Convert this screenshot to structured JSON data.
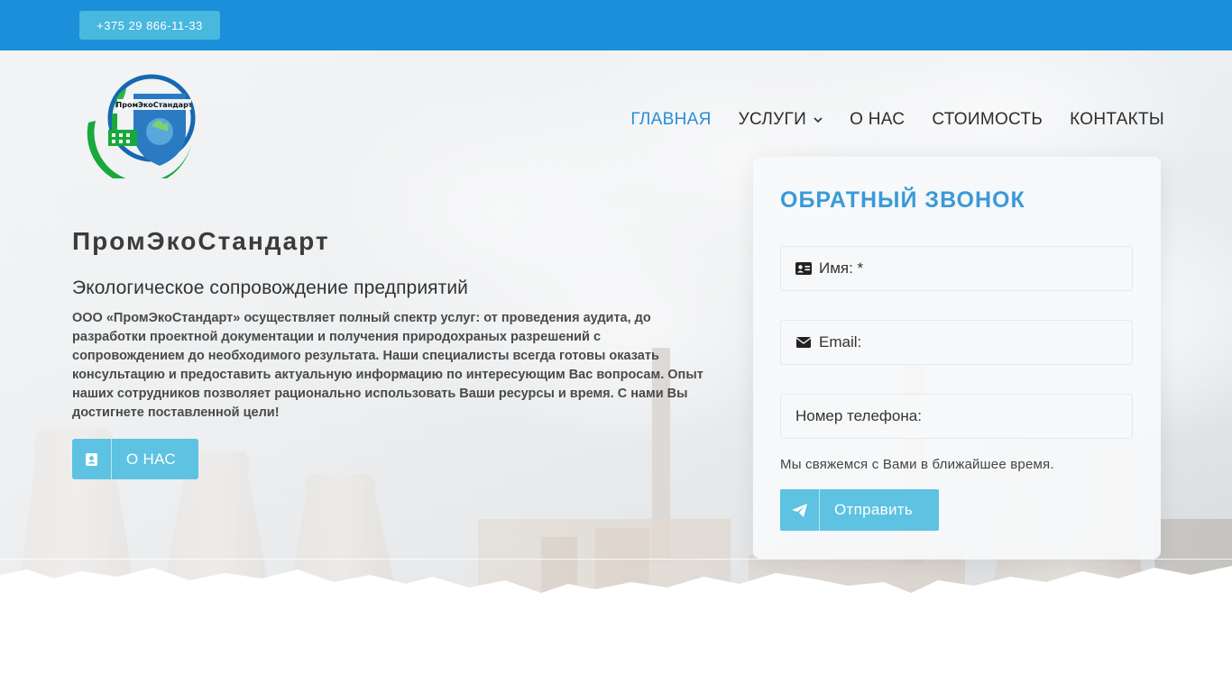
{
  "topbar": {
    "phone": "+375 29 866-11-33"
  },
  "logo": {
    "text": "ПромЭкоСтандарт",
    "icon": "company-logo-icon"
  },
  "nav": {
    "items": [
      {
        "label": "ГЛАВНАЯ",
        "active": true
      },
      {
        "label": "УСЛУГИ",
        "has_dropdown": true
      },
      {
        "label": "О НАС"
      },
      {
        "label": "СТОИМОСТЬ"
      },
      {
        "label": "КОНТАКТЫ"
      }
    ]
  },
  "hero": {
    "brand": "ПромЭкоСтандарт",
    "subtitle": "Экологическое сопровождение предприятий",
    "description": "ООО «ПромЭкоСтандарт» осуществляет полный спектр услуг: от проведения аудита, до разработки проектной документации и получения природохраных разрешений с сопровождением до необходимого результата. Наши специалисты всегда готовы  оказать консультацию и предоставить актуальную информацию по интересующим Вас вопросам. Опыт наших сотрудников позволяет рационально использовать Ваши ресурсы и время. С нами Вы достигнете поставленной цели!",
    "about_button": "О НАС"
  },
  "form": {
    "title": "ОБРАТНЫЙ ЗВОНОК",
    "name_placeholder": "Имя: *",
    "email_placeholder": "Email:",
    "phone_placeholder": "Номер телефона:",
    "note": "Мы свяжемся с Вами в ближайшее время.",
    "submit": "Отправить"
  },
  "colors": {
    "topbar": "#1b8fd9",
    "accent": "#2a8ed6",
    "button": "#5ec2e2",
    "title": "#3a9ad9"
  }
}
